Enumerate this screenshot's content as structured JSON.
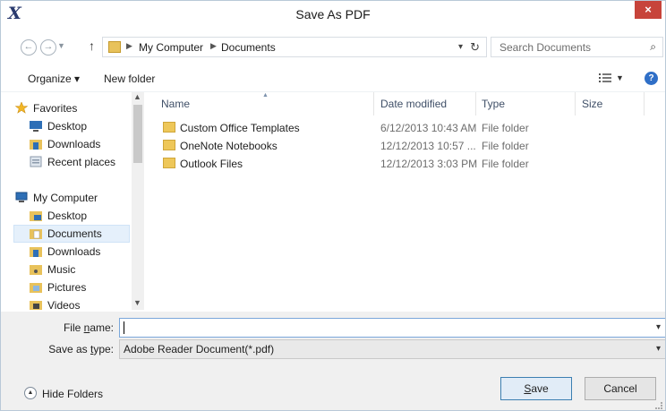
{
  "window": {
    "logo": "X",
    "title": "Save As PDF",
    "close_glyph": "×"
  },
  "address_bar": {
    "breadcrumbs": [
      "My Computer",
      "Documents"
    ]
  },
  "search": {
    "placeholder": "Search Documents"
  },
  "toolbar": {
    "organize_label": "Organize ▾",
    "new_folder_label": "New folder"
  },
  "sidebar": {
    "items": [
      {
        "label": "Favorites",
        "icon": "star-icon"
      },
      {
        "label": "Desktop",
        "icon": "desktop-icon"
      },
      {
        "label": "Downloads",
        "icon": "downloads-icon"
      },
      {
        "label": "Recent places",
        "icon": "recent-places-icon"
      },
      {
        "label": "My Computer",
        "icon": "computer-icon"
      },
      {
        "label": "Desktop",
        "icon": "desktop-folder-icon"
      },
      {
        "label": "Documents",
        "icon": "documents-folder-icon",
        "selected": true
      },
      {
        "label": "Downloads",
        "icon": "downloads-folder-icon"
      },
      {
        "label": "Music",
        "icon": "music-folder-icon"
      },
      {
        "label": "Pictures",
        "icon": "pictures-folder-icon"
      },
      {
        "label": "Videos",
        "icon": "videos-folder-icon"
      }
    ]
  },
  "file_list": {
    "columns": [
      "Name",
      "Date modified",
      "Type",
      "Size"
    ],
    "rows": [
      {
        "name": "Custom Office Templates",
        "date": "6/12/2013 10:43 AM",
        "type": "File folder",
        "size": ""
      },
      {
        "name": "OneNote Notebooks",
        "date": "12/12/2013 10:57 ...",
        "type": "File folder",
        "size": ""
      },
      {
        "name": "Outlook Files",
        "date": "12/12/2013 3:03 PM",
        "type": "File folder",
        "size": ""
      }
    ]
  },
  "fields": {
    "file_name_label_pre": "File ",
    "file_name_label_u": "n",
    "file_name_label_post": "ame:",
    "file_name_value": "",
    "save_type_label_pre": "Save as ",
    "save_type_label_u": "t",
    "save_type_label_post": "ype:",
    "save_type_value": "Adobe Reader Document(*.pdf)"
  },
  "footer": {
    "hide_folders_label": "Hide Folders",
    "save_label_u": "S",
    "save_label_rest": "ave",
    "cancel_label": "Cancel"
  },
  "colors": {
    "selection_bg": "#e5f0fb",
    "close_red": "#c7443b",
    "header_text": "#3f4f67"
  }
}
